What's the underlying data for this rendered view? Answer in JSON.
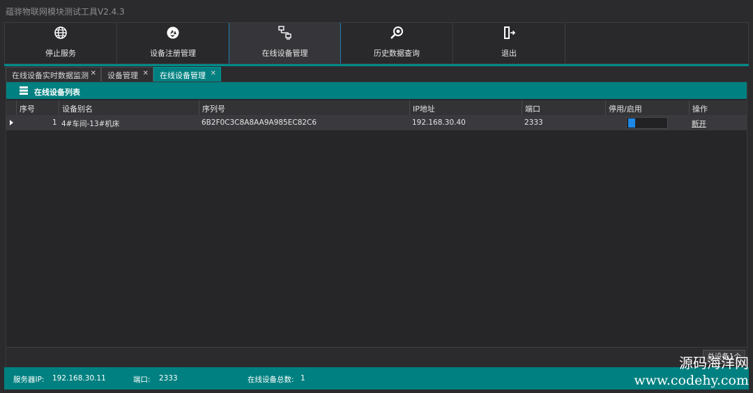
{
  "app": {
    "title": "蕴骅物联网模块测试工具V2.4.3"
  },
  "toolbar": {
    "buttons": [
      {
        "label": "停止服务",
        "icon": "globe-icon"
      },
      {
        "label": "设备注册管理",
        "icon": "recycle-icon"
      },
      {
        "label": "在线设备管理",
        "icon": "network-icon"
      },
      {
        "label": "历史数据查询",
        "icon": "magnifier-icon"
      },
      {
        "label": "退出",
        "icon": "exit-door-icon"
      }
    ],
    "active": "在线设备管理"
  },
  "tabs": [
    {
      "label": "在线设备实时数据监测",
      "close": "✕"
    },
    {
      "label": "设备管理",
      "close": "✕"
    },
    {
      "label": "在线设备管理",
      "close": "✕"
    }
  ],
  "panel": {
    "title": "在线设备列表",
    "icon": "server-list-icon"
  },
  "grid": {
    "columns": [
      "序号",
      "设备别名",
      "序列号",
      "IP地址",
      "端口",
      "停用/启用",
      "操作"
    ],
    "rows": [
      {
        "index": "1",
        "alias": "4#车间-13#机床",
        "serial": "6B2F0C3C8A8AA9A985EC82C6",
        "ip": "192.168.30.40",
        "port": "2333",
        "enabled": false,
        "action": "断开"
      }
    ],
    "footer_count": "总设备1个"
  },
  "status": {
    "server_ip_label": "服务器IP:",
    "server_ip": "192.168.30.11",
    "port_label": "端口:",
    "port": "2333",
    "online_label": "在线设备总数:",
    "online_count": "1"
  },
  "watermark": {
    "line1": "源码海洋网",
    "line2": "www.codehy.com"
  },
  "colors": {
    "accent": "#008080",
    "active_border": "#1f7fb0",
    "toggle_knob": "#1e88e5"
  }
}
